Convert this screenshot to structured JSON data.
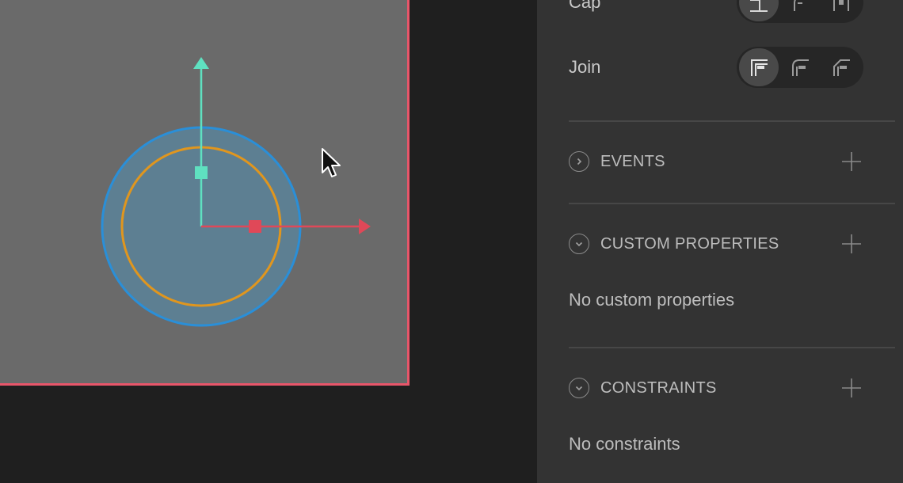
{
  "inspector": {
    "cap": {
      "label": "Cap",
      "options": [
        "butt-cap-icon",
        "round-cap-icon",
        "square-cap-icon"
      ],
      "selected": 0
    },
    "join": {
      "label": "Join",
      "options": [
        "miter-join-icon",
        "round-join-icon",
        "bevel-join-icon"
      ],
      "selected": 0
    },
    "sections": {
      "events": {
        "title": "EVENTS",
        "expanded": false
      },
      "custom_properties": {
        "title": "CUSTOM PROPERTIES",
        "expanded": true,
        "empty_text": "No custom properties"
      },
      "constraints": {
        "title": "CONSTRAINTS",
        "expanded": true,
        "empty_text": "No constraints"
      }
    }
  },
  "colors": {
    "artboard_border": "#e8566a",
    "selection_blue": "#2a8fd8",
    "stroke_orange": "#e0961e",
    "y_axis": "#5fe0c0",
    "x_axis": "#e04858"
  }
}
